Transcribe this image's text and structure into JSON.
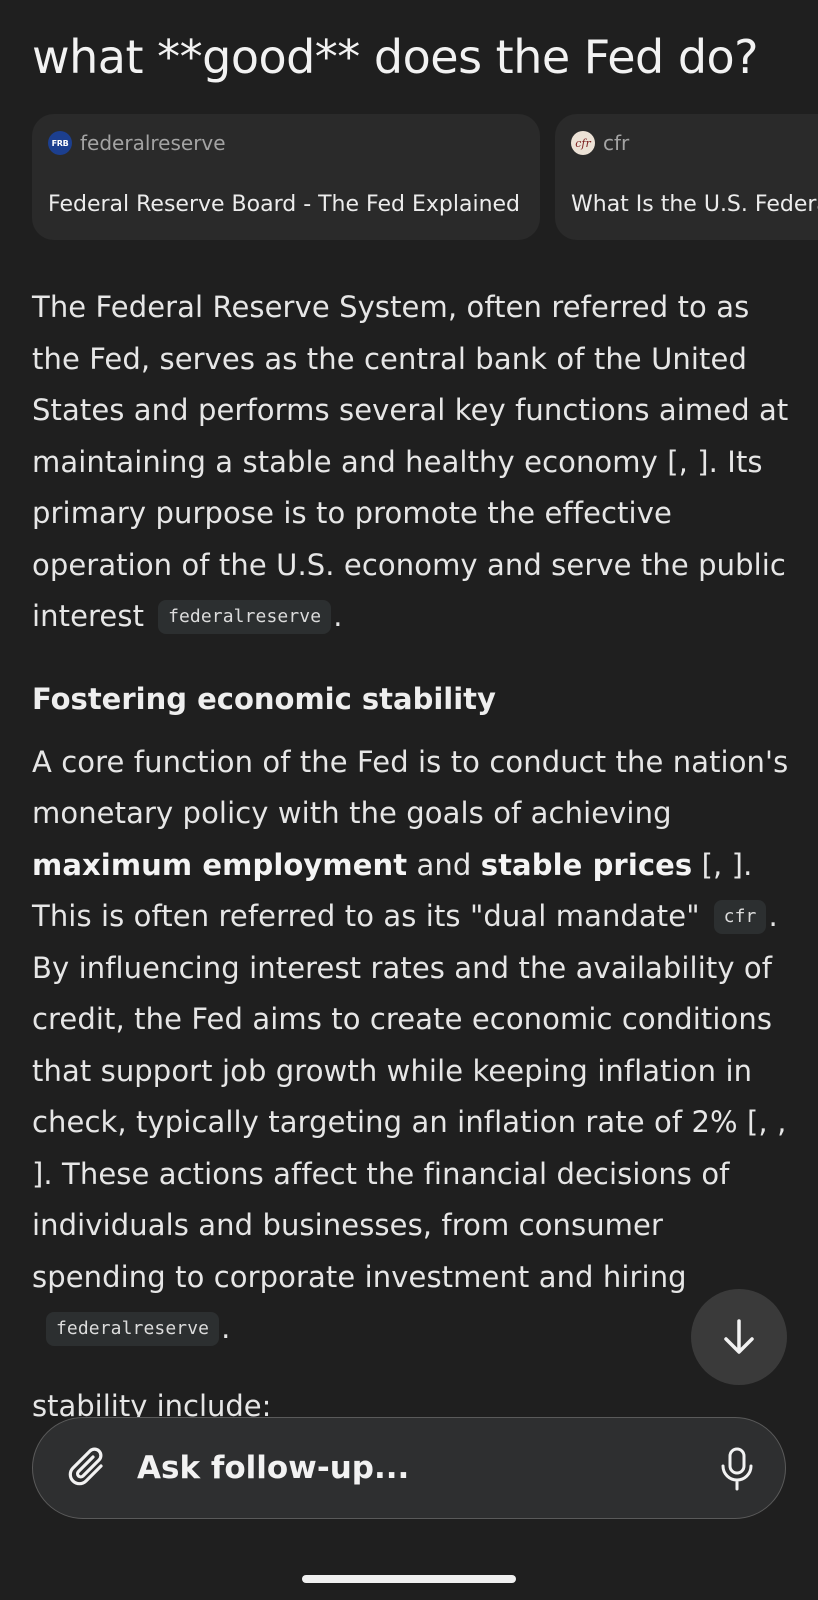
{
  "query": "what **good** does the Fed do?",
  "sources": [
    {
      "favicon_text": "FRB",
      "domain": "federalreserve",
      "title": "Federal Reserve Board - The Fed Explained"
    },
    {
      "favicon_text": "cfr",
      "domain": "cfr",
      "title": "What Is the U.S. Federal Reserve?"
    }
  ],
  "answer": {
    "p1": {
      "text": "The Federal Reserve System, often referred to as the Fed, serves as the central bank of the United States and performs several key functions aimed at maintaining a stable and healthy economy [, ]. Its primary purpose is to promote the effective operation of the U.S. economy and serve the public interest",
      "chip": "federalreserve",
      "end": "."
    },
    "section_heading": "Fostering economic stability",
    "p2": {
      "t1": "A core function of the Fed is to conduct the nation's monetary policy with the goals of achieving ",
      "b1": "maximum employment",
      "t2": " and ",
      "b2": "stable prices",
      "t3": " [, ]. This is often referred to as its \"dual mandate\"",
      "chip1": "cfr",
      "t4": ". By influencing interest rates and the availability of credit, the Fed aims to create economic conditions that support job growth while keeping inflation in check, typically targeting an inflation rate of 2% [, , ]. These actions affect the financial decisions of individuals and businesses, from consumer spending to corporate investment and hiring",
      "chip2": "federalreserve",
      "end": "."
    },
    "obscured_tail": "stability include:"
  },
  "input": {
    "placeholder": "Ask follow-up..."
  },
  "icons": {
    "attach": "paperclip-icon",
    "mic": "microphone-icon",
    "scroll": "arrow-down-icon"
  },
  "colors": {
    "background": "#1f1f1f",
    "card": "#2a2a2a",
    "chip": "#2c2f30",
    "input_border": "#5a5a5a"
  }
}
